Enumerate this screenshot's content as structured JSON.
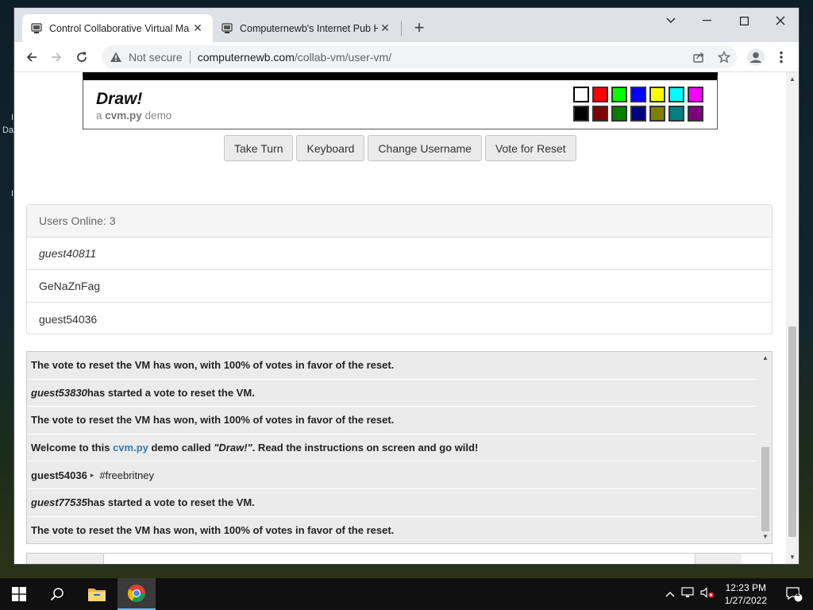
{
  "browser": {
    "tabs": [
      {
        "title": "Control Collaborative Virtual Ma",
        "active": true
      },
      {
        "title": "Computernewb's Internet Pub H",
        "active": false
      }
    ],
    "new_tab_label": "+",
    "close_glyph": "✕",
    "address": {
      "security_label": "Not secure",
      "host": "computernewb.com",
      "path": "/collab-vm/user-vm/"
    }
  },
  "page": {
    "canvas": {
      "title": "Draw!",
      "subtitle_prefix": "a ",
      "subtitle_bold": "cvm.py",
      "subtitle_suffix": " demo",
      "palette": [
        "#ffffff",
        "#ff0000",
        "#00ff00",
        "#0000ff",
        "#ffff00",
        "#00ffff",
        "#ff00ff",
        "#000000",
        "#800000",
        "#008000",
        "#000080",
        "#808000",
        "#008080",
        "#800080"
      ],
      "selected_color": "#ffffff"
    },
    "buttons": {
      "take_turn": "Take Turn",
      "keyboard": "Keyboard",
      "change_username": "Change Username",
      "vote_reset": "Vote for Reset"
    },
    "users": {
      "header": "Users Online: 3",
      "list": [
        "guest40811",
        "GeNaZnFag",
        "guest54036"
      ]
    },
    "chat": {
      "messages": [
        {
          "type": "system",
          "text": "The vote to reset the VM has won, with 100% of votes in favor of the reset."
        },
        {
          "type": "vote",
          "user": "guest53830",
          "text": " has started a vote to reset the VM."
        },
        {
          "type": "system",
          "text": "The vote to reset the VM has won, with 100% of votes in favor of the reset."
        },
        {
          "type": "welcome",
          "pre": "Welcome to this ",
          "link": "cvm.py",
          "mid": " demo called ",
          "quote": "\"Draw!\"",
          "post": ". Read the instructions on screen and go wild!"
        },
        {
          "type": "chat",
          "user": "guest54036",
          "arrow": "▸",
          "text": "#freebritney"
        },
        {
          "type": "vote",
          "user": "guest77535",
          "text": " has started a vote to reset the VM."
        },
        {
          "type": "system",
          "text": "The vote to reset the VM has won, with 100% of votes in favor of the reset."
        }
      ]
    }
  },
  "taskbar": {
    "time": "12:23 PM",
    "date": "1/27/2022",
    "notification_count": "1"
  },
  "desktop": {
    "fragments": [
      "I",
      "Da",
      "I"
    ]
  },
  "colors": {
    "tabstrip_bg": "#dee1e6",
    "link": "#337ab7",
    "chat_bg": "#ebebeb"
  }
}
